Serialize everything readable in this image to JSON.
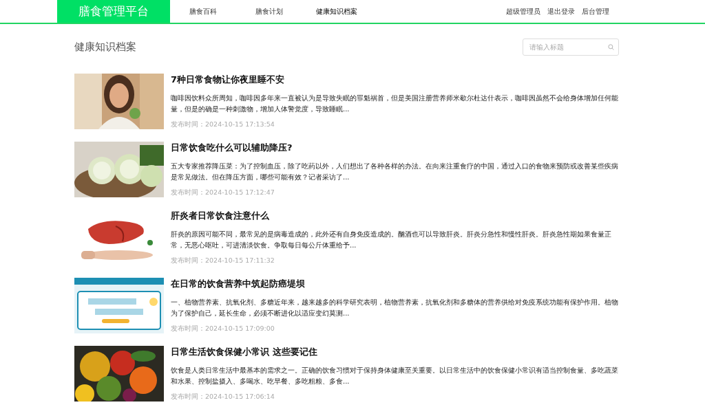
{
  "header": {
    "logo": "膳食管理平台",
    "nav": [
      {
        "label": "膳食百科",
        "selected": false
      },
      {
        "label": "膳食计划",
        "selected": false
      },
      {
        "label": "健康知识档案",
        "selected": true
      }
    ],
    "user_links": [
      "超级管理员",
      "退出登录",
      "后台管理"
    ]
  },
  "page_title": "健康知识档案",
  "search": {
    "placeholder": "请输入标题"
  },
  "articles": [
    {
      "title": "7种日常食物让你夜里睡不安",
      "summary": "咖啡因饮料众所周知，咖啡因多年来一直被认为是导致失眠的罪魁祸首，但是美国注册营养师米歇尔杜达什表示，咖啡因虽然不会给身体增加任何能量，但是的确是一种刺激物，增加人体警觉度，导致睡眠...",
      "date_label": "发布时间：",
      "date": "2024-10-15 17:13:54"
    },
    {
      "title": "日常饮食吃什么可以辅助降压?",
      "summary": "五大专家推荐降压菜：为了控制血压，除了吃药以外，人们想出了各种各样的办法。在向来注重食疗的中国，通过入口的食物来预防或改善某些疾病是常见做法。但在降压方面，哪些可能有效？记者采访了...",
      "date_label": "发布时间：",
      "date": "2024-10-15 17:12:47"
    },
    {
      "title": "肝炎者日常饮食注意什么",
      "summary": "肝炎的原因可能不同，最常见的是病毒造成的，此外还有自身免疫造成的。酗酒也可以导致肝炎。肝炎分急性和慢性肝炎。肝炎急性期如果食量正常，无恶心呕吐，可进清淡饮食。争取每日每公斤体重给予...",
      "date_label": "发布时间：",
      "date": "2024-10-15 17:11:32"
    },
    {
      "title": "在日常的饮食营养中筑起防癌堤坝",
      "summary": "一、植物营养素、抗氧化剂、多糖近年来，越来越多的科学研究表明，植物营养素，抗氧化剂和多糖体的营养供给对免疫系统功能有保护作用。植物为了保护自己，延长生命，必须不断进化以适应变幻莫测...",
      "date_label": "发布时间：",
      "date": "2024-10-15 17:09:00"
    },
    {
      "title": "日常生活饮食保健小常识 这些要记住",
      "summary": "饮食是人类日常生活中最基本的需求之一。正确的饮食习惯对于保持身体健康至关重要。以日常生活中的饮食保健小常识有适当控制食量、多吃蔬菜和水果、控制盐摄入、多喝水、吃早餐、多吃粗粮、多食...",
      "date_label": "发布时间：",
      "date": "2024-10-15 17:06:14"
    }
  ]
}
